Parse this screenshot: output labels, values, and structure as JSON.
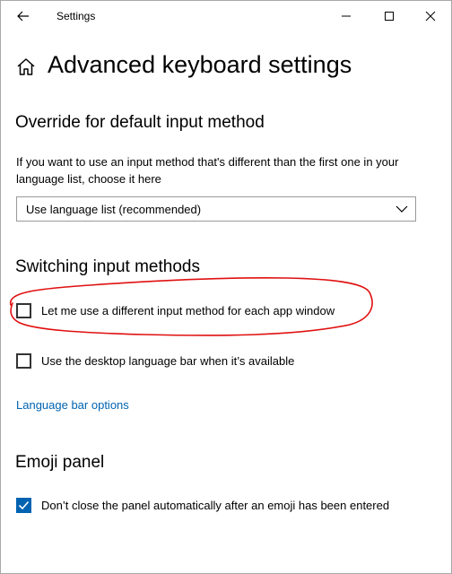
{
  "titlebar": {
    "title": "Settings",
    "back_icon": "back-arrow-icon",
    "minimize_icon": "minimize-icon",
    "maximize_icon": "maximize-icon",
    "close_icon": "close-icon"
  },
  "header": {
    "home_icon": "home-icon",
    "title": "Advanced keyboard settings"
  },
  "override": {
    "title": "Override for default input method",
    "description": "If you want to use an input method that's different than the first one in your language list, choose it here",
    "dropdown_value": "Use language list (recommended)"
  },
  "switching": {
    "title": "Switching input methods",
    "option1_label": "Let me use a different input method for each app window",
    "option1_checked": false,
    "option2_label": "Use the desktop language bar when it’s available",
    "option2_checked": false,
    "link_label": "Language bar options"
  },
  "emoji": {
    "title": "Emoji panel",
    "option_label": "Don’t close the panel automatically after an emoji has been entered",
    "option_checked": true
  },
  "colors": {
    "accent": "#0063b1",
    "annotation": "#e01010"
  }
}
